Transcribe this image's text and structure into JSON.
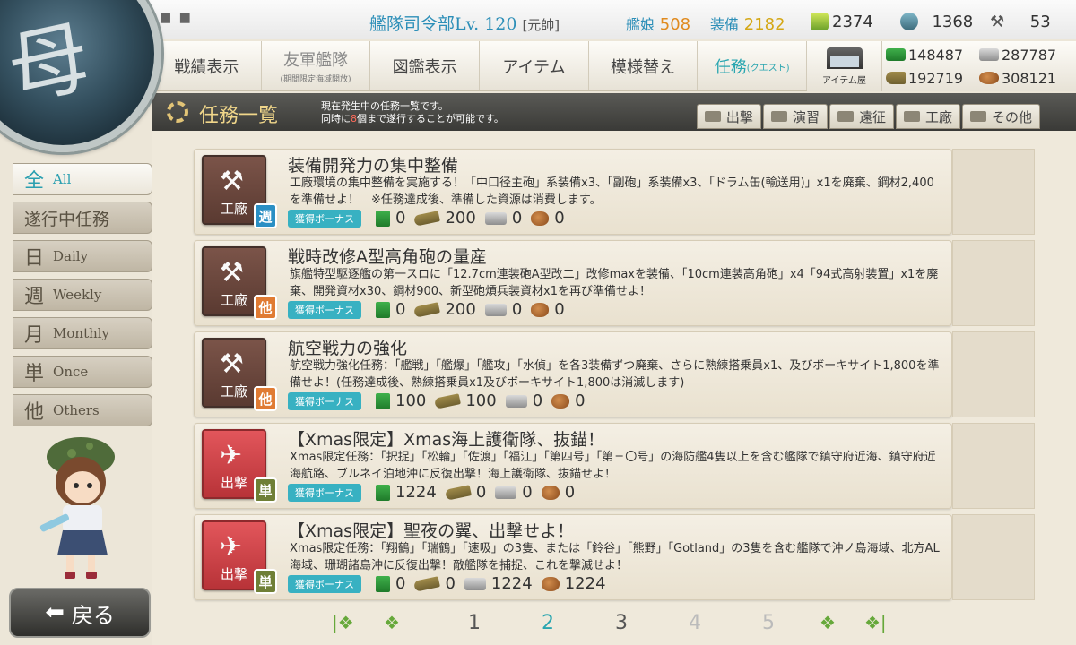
{
  "header": {
    "rank_label": "艦隊司令部Lv.",
    "level": "120",
    "title": "[元帥]",
    "ships_label": "艦娘",
    "ships_count": "508",
    "equip_label": "装備",
    "equip_count": "2182",
    "bucket": "2374",
    "screw": "1368",
    "hammer": "53"
  },
  "nav": {
    "items": [
      {
        "label": "戦績表示",
        "sub": ""
      },
      {
        "label": "友軍艦隊",
        "sub": "(期間限定海域開放)"
      },
      {
        "label": "図鑑表示",
        "sub": ""
      },
      {
        "label": "アイテム",
        "sub": ""
      },
      {
        "label": "模様替え",
        "sub": ""
      },
      {
        "label": "任務",
        "sub": "(クエスト)"
      }
    ],
    "item_shop": "アイテム屋"
  },
  "materials": {
    "fuel": "148487",
    "steel": "287787",
    "ammo": "192719",
    "bauxite": "308121"
  },
  "quest_header": {
    "title": "任務一覧",
    "desc_line1": "現在発生中の任務一覧です。",
    "desc_line2_a": "同時に",
    "desc_line2_num": "8",
    "desc_line2_b": "個まで遂行することが可能です。"
  },
  "filter_tabs": [
    "出撃",
    "演習",
    "遠征",
    "工廠",
    "その他"
  ],
  "sidebar": [
    {
      "kanji": "全",
      "en": "All"
    },
    {
      "kanji": "遂行中任務",
      "en": ""
    },
    {
      "kanji": "日",
      "en": "Daily"
    },
    {
      "kanji": "週",
      "en": "Weekly"
    },
    {
      "kanji": "月",
      "en": "Monthly"
    },
    {
      "kanji": "単",
      "en": "Once"
    },
    {
      "kanji": "他",
      "en": "Others"
    }
  ],
  "bonus_label": "獲得ボーナス",
  "quests": [
    {
      "category": "工廠",
      "badge": "週",
      "title": "装備開発力の集中整備",
      "desc": "工廠環境の集中整備を実施する！「中口径主砲」系装備x3、「副砲」系装備x3、「ドラム缶(輸送用)」x1を廃棄、鋼材2,400を準備せよ！　※任務達成後、準備した資源は消費します。",
      "fuel": "0",
      "ammo": "200",
      "steel": "0",
      "bauxite": "0"
    },
    {
      "category": "工廠",
      "badge": "他",
      "title": "戦時改修A型高角砲の量産",
      "desc": "旗艦特型駆逐艦の第一スロに「12.7cm連装砲A型改二」改修maxを装備、「10cm連装高角砲」x4「94式高射装置」x1を廃棄、開発資材x30、鋼材900、新型砲熕兵装資材x1を再び準備せよ！",
      "fuel": "0",
      "ammo": "200",
      "steel": "0",
      "bauxite": "0"
    },
    {
      "category": "工廠",
      "badge": "他",
      "title": "航空戦力の強化",
      "desc": "航空戦力強化任務：「艦戦」「艦爆」「艦攻」「水偵」を各3装備ずつ廃棄、さらに熟練搭乗員x1、及びボーキサイト1,800を準備せよ！(任務達成後、熟練搭乗員x1及びボーキサイト1,800は消滅します)",
      "fuel": "100",
      "ammo": "100",
      "steel": "0",
      "bauxite": "0"
    },
    {
      "category": "出撃",
      "badge": "単",
      "title": "【Xmas限定】Xmas海上護衛隊、抜錨！",
      "desc": "Xmas限定任務：「択捉」「松輪」「佐渡」「福江」「第四号」「第三〇号」の海防艦4隻以上を含む艦隊で鎮守府近海、鎮守府近海航路、ブルネイ泊地沖に反復出撃！海上護衛隊、抜錨せよ！",
      "fuel": "1224",
      "ammo": "0",
      "steel": "0",
      "bauxite": "0"
    },
    {
      "category": "出撃",
      "badge": "単",
      "title": "【Xmas限定】聖夜の翼、出撃せよ！",
      "desc": "Xmas限定任務：「翔鶴」「瑞鶴」「速吸」の3隻、または「鈴谷」「熊野」「Gotland」の3隻を含む艦隊で沖ノ島海域、北方AL海域、珊瑚諸島沖に反復出撃！敵艦隊を捕捉、これを撃滅せよ！",
      "fuel": "0",
      "ammo": "0",
      "steel": "1224",
      "bauxite": "1224"
    }
  ],
  "back_label": "戻る",
  "pager": {
    "pages": [
      "1",
      "2",
      "3",
      "4",
      "5"
    ],
    "current": "2"
  },
  "colors": {
    "accent": "#2aa6b0",
    "factory": "#6b463c",
    "sortie": "#d6454a",
    "bonus": "#38b1c2"
  }
}
